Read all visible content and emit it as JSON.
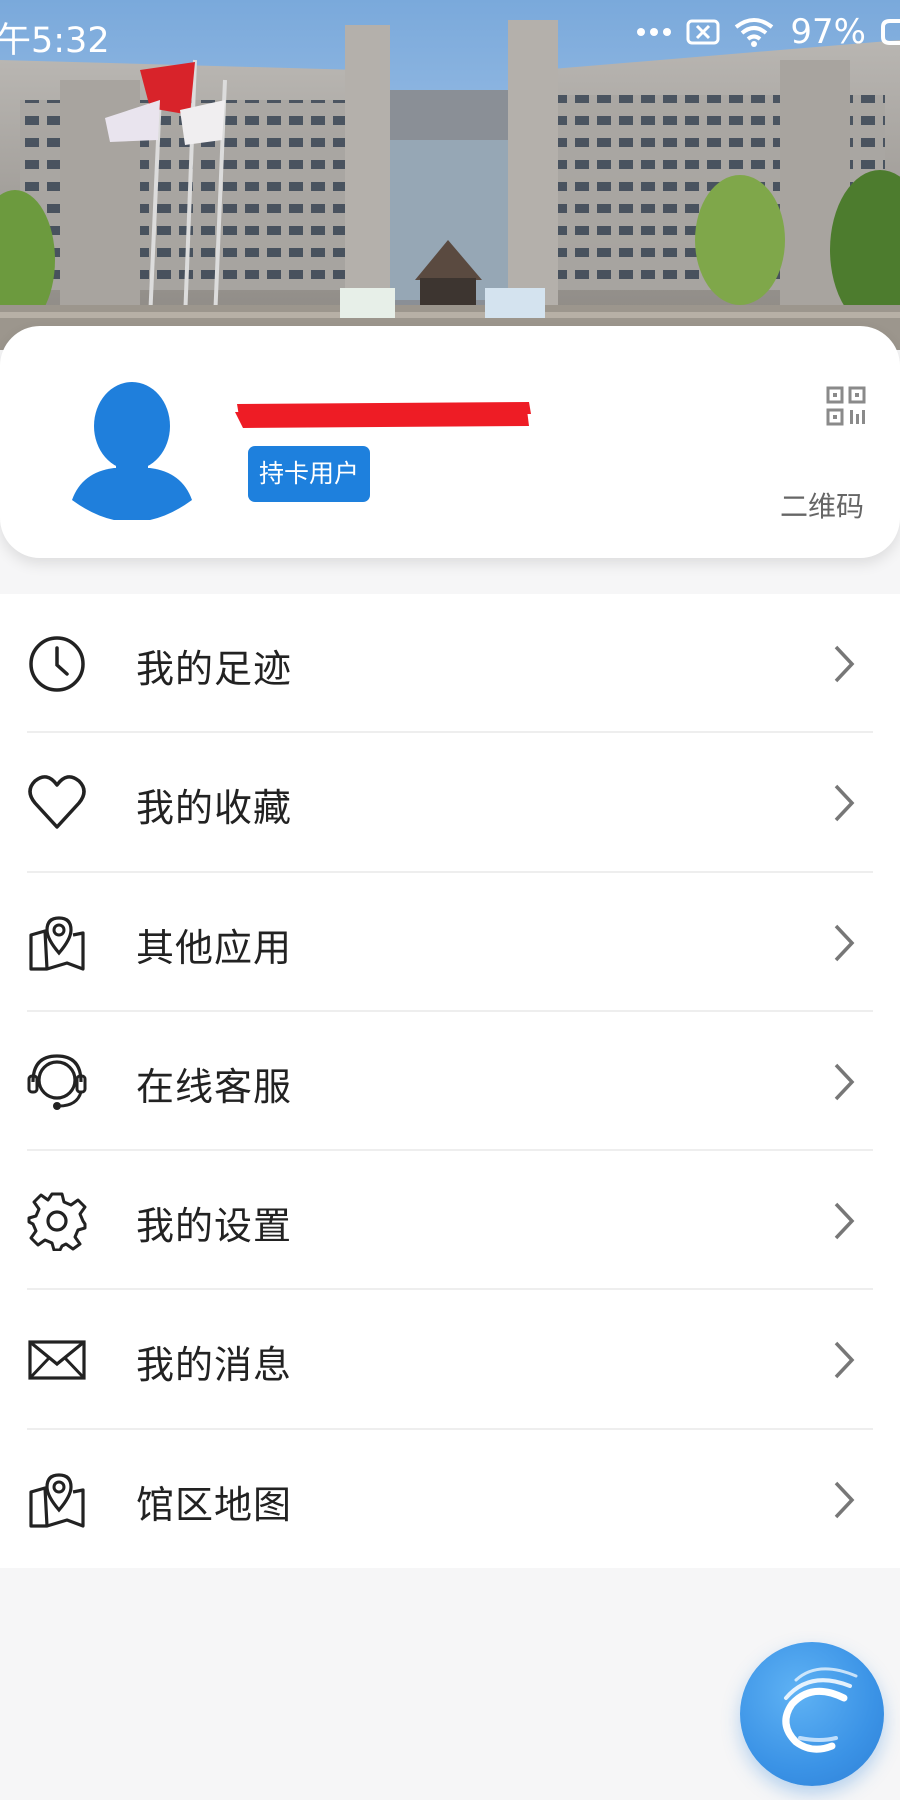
{
  "status_bar": {
    "time": "午5:32",
    "battery": "97%"
  },
  "profile": {
    "name_redacted": true,
    "badge": "持卡用户",
    "qr_label": "二维码"
  },
  "menu": {
    "items": [
      {
        "label": "我的足迹",
        "icon": "clock-icon"
      },
      {
        "label": "我的收藏",
        "icon": "heart-icon"
      },
      {
        "label": "其他应用",
        "icon": "map-pin-icon"
      },
      {
        "label": "在线客服",
        "icon": "headset-icon"
      },
      {
        "label": "我的设置",
        "icon": "gear-icon"
      },
      {
        "label": "我的消息",
        "icon": "envelope-icon"
      },
      {
        "label": "馆区地图",
        "icon": "map-pin-icon"
      }
    ]
  },
  "colors": {
    "accent": "#1e80dd",
    "redaction": "#ee1c25",
    "fab": "#3b93e6"
  }
}
